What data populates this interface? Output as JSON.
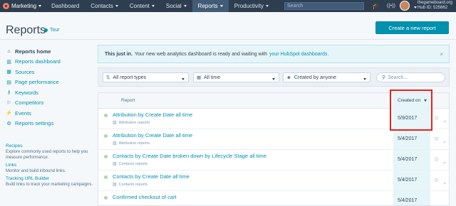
{
  "topnav": {
    "brand": "Marketing",
    "items": [
      "Dashboard",
      "Contacts",
      "Content",
      "Social",
      "Reports",
      "Productivity"
    ],
    "active": "Reports",
    "search_placeholder": "Search",
    "account_name": "thegameboard.org",
    "hub_id": "Hub ID: 525862"
  },
  "header": {
    "title": "Reports",
    "tour_label": "Tour",
    "create_button": "Create a new report"
  },
  "sidebar": {
    "items": [
      {
        "label": "Reports home",
        "icon": "home-icon",
        "glyph": "⌂"
      },
      {
        "label": "Reports dashboard",
        "icon": "chart-icon",
        "glyph": "▥"
      },
      {
        "label": "Sources",
        "icon": "sources-icon",
        "glyph": "▦"
      },
      {
        "label": "Page performance",
        "icon": "page-icon",
        "glyph": "▤"
      },
      {
        "label": "Keywords",
        "icon": "key-icon",
        "glyph": "⚷"
      },
      {
        "label": "Competitors",
        "icon": "competitors-icon",
        "glyph": "⚐"
      },
      {
        "label": "Events",
        "icon": "events-icon",
        "glyph": "⚡"
      },
      {
        "label": "Reports settings",
        "icon": "gear-icon",
        "glyph": "⚙"
      }
    ],
    "links": [
      {
        "label": "Recipes",
        "desc": "Explore commonly used reports to help you measure performance."
      },
      {
        "label": "Links",
        "desc": "Monitor and build inbound links."
      },
      {
        "label": "Tracking URL Builder",
        "desc": "Build links to track your marketing campaigns."
      }
    ]
  },
  "alert": {
    "bold": "This just in.",
    "text": "Your new web analytics dashboard is ready and waiting with",
    "link": "your HubSpot dashboards.",
    "close": "×"
  },
  "filters": {
    "report_types": "All report types",
    "time": "All time",
    "created_by": "Created by anyone",
    "search_placeholder": "Search..."
  },
  "table": {
    "col_report": "Report",
    "col_created": "Created on",
    "rows": [
      {
        "name": "Attribution by Create Date all time",
        "type": "Attribution reports",
        "date": "5/9/2017"
      },
      {
        "name": "Attribution by Create Date all time",
        "type": "Attribution reports",
        "date": "5/4/2017"
      },
      {
        "name": "Contacts by Create Date broken down by Lifecycle Stage all time",
        "type": "Contacts reports",
        "date": "5/4/2017"
      },
      {
        "name": "Contacts by Create Date all time",
        "type": "Contacts reports",
        "date": "5/4/2017"
      },
      {
        "name": "Confirmed checkout of cart",
        "type": "",
        "date": "5/4/2017"
      }
    ]
  },
  "colors": {
    "nav_bg": "#2d3e50",
    "accent": "#0091ae",
    "highlight": "#e8211c"
  }
}
